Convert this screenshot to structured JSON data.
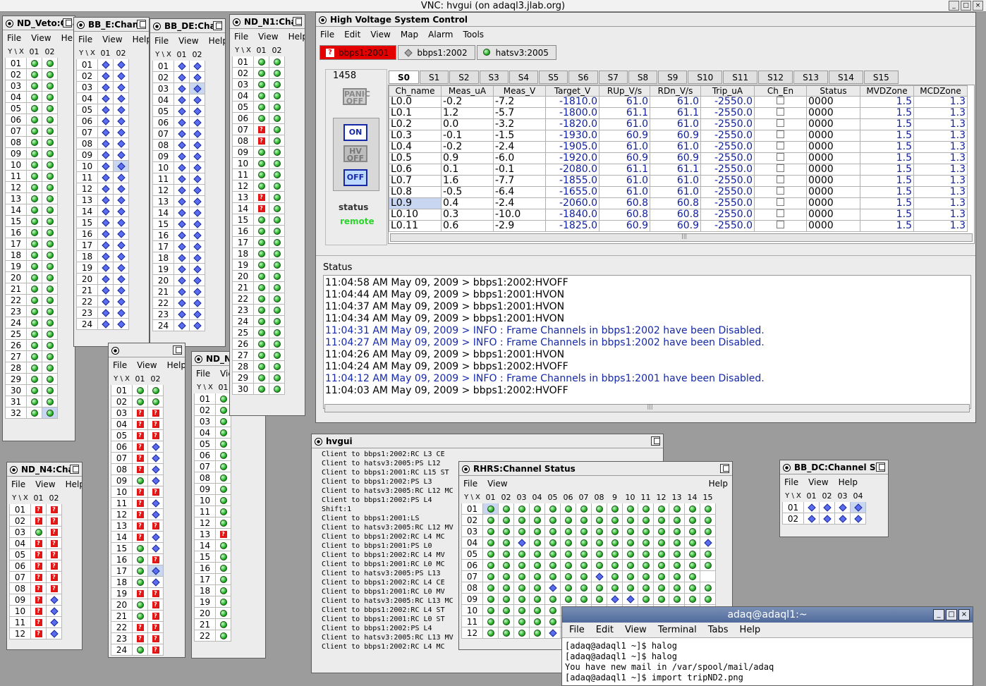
{
  "vnc_title": "VNC: hvgui (on adaql3.jlab.org)",
  "vnc_buttons": [
    "_",
    "□",
    "×"
  ],
  "menu_small": [
    "File",
    "View",
    "Help"
  ],
  "menus_hv": [
    "File",
    "Edit",
    "View",
    "Map",
    "Alarm",
    "Tools"
  ],
  "icons": {
    "green": "green-circle-icon",
    "blue": "blue-diamond-icon",
    "red": "red-question-icon"
  },
  "grid_windows": [
    {
      "id": "nd-veto",
      "title": "ND_Veto:Cha",
      "cols": [
        "01",
        "02"
      ],
      "rows": [
        [
          "01",
          "gg"
        ],
        [
          "02",
          "gg"
        ],
        [
          "03",
          "gg"
        ],
        [
          "04",
          "gg"
        ],
        [
          "05",
          "gg"
        ],
        [
          "06",
          "gg"
        ],
        [
          "07",
          "gg"
        ],
        [
          "08",
          "gg"
        ],
        [
          "09",
          "gg"
        ],
        [
          "10",
          "gg"
        ],
        [
          "11",
          "gg"
        ],
        [
          "12",
          "gg"
        ],
        [
          "13",
          "gg"
        ],
        [
          "14",
          "gg"
        ],
        [
          "15",
          "gg"
        ],
        [
          "16",
          "gg"
        ],
        [
          "17",
          "gg"
        ],
        [
          "18",
          "gg"
        ],
        [
          "19",
          "gg"
        ],
        [
          "20",
          "gg"
        ],
        [
          "21",
          "gg"
        ],
        [
          "22",
          "gg"
        ],
        [
          "23",
          "gg"
        ],
        [
          "24",
          "gg"
        ],
        [
          "25",
          "gg"
        ],
        [
          "26",
          "gg"
        ],
        [
          "27",
          "gg"
        ],
        [
          "28",
          "gg"
        ],
        [
          "29",
          "gg"
        ],
        [
          "30",
          "gg"
        ],
        [
          "31",
          "gg"
        ],
        [
          "32",
          "gG"
        ]
      ]
    },
    {
      "id": "bb-e",
      "title": "BB_E:Chan",
      "cols": [
        "01",
        "02"
      ],
      "rows": [
        [
          "01",
          "bb"
        ],
        [
          "02",
          "bb"
        ],
        [
          "03",
          "bb"
        ],
        [
          "04",
          "bb"
        ],
        [
          "05",
          "bb"
        ],
        [
          "06",
          "bb"
        ],
        [
          "07",
          "bb"
        ],
        [
          "08",
          "bb"
        ],
        [
          "09",
          "bb"
        ],
        [
          "10",
          "bB"
        ],
        [
          "11",
          "bb"
        ],
        [
          "12",
          "bb"
        ],
        [
          "13",
          "bb"
        ],
        [
          "14",
          "bb"
        ],
        [
          "15",
          "bb"
        ],
        [
          "16",
          "bb"
        ],
        [
          "17",
          "bb"
        ],
        [
          "18",
          "bb"
        ],
        [
          "19",
          "bb"
        ],
        [
          "20",
          "bb"
        ],
        [
          "21",
          "bb"
        ],
        [
          "22",
          "bb"
        ],
        [
          "23",
          "bb"
        ],
        [
          "24",
          "bb"
        ]
      ]
    },
    {
      "id": "bb-de",
      "title": "BB_DE:Cha",
      "cols": [
        "01",
        "02"
      ],
      "rows": [
        [
          "01",
          "bb"
        ],
        [
          "02",
          "bb"
        ],
        [
          "03",
          "bB"
        ],
        [
          "04",
          "bb"
        ],
        [
          "05",
          "bb"
        ],
        [
          "06",
          "bb"
        ],
        [
          "07",
          "bb"
        ],
        [
          "08",
          "bb"
        ],
        [
          "09",
          "bb"
        ],
        [
          "10",
          "bb"
        ],
        [
          "11",
          "bb"
        ],
        [
          "12",
          "bb"
        ],
        [
          "13",
          "bb"
        ],
        [
          "14",
          "bb"
        ],
        [
          "15",
          "bb"
        ],
        [
          "16",
          "bb"
        ],
        [
          "17",
          "bb"
        ],
        [
          "18",
          "bb"
        ],
        [
          "19",
          "bb"
        ],
        [
          "20",
          "bb"
        ],
        [
          "21",
          "bb"
        ],
        [
          "22",
          "bb"
        ],
        [
          "23",
          "bb"
        ],
        [
          "24",
          "bb"
        ]
      ]
    },
    {
      "id": "nd-n1",
      "title": "ND_N1:Cha",
      "cols": [
        "01",
        "02"
      ],
      "rows": [
        [
          "01",
          "gg"
        ],
        [
          "02",
          "gg"
        ],
        [
          "03",
          "gg"
        ],
        [
          "04",
          "gg"
        ],
        [
          "05",
          "gg"
        ],
        [
          "06",
          "gg"
        ],
        [
          "07",
          "rg"
        ],
        [
          "08",
          "rg"
        ],
        [
          "09",
          "gg"
        ],
        [
          "10",
          "gg"
        ],
        [
          "11",
          "gg"
        ],
        [
          "12",
          "gg"
        ],
        [
          "13",
          "rg"
        ],
        [
          "14",
          "rg"
        ],
        [
          "15",
          "gg"
        ],
        [
          "16",
          "gg"
        ],
        [
          "17",
          "gg"
        ],
        [
          "18",
          "gg"
        ],
        [
          "19",
          "gg"
        ],
        [
          "20",
          "gg"
        ],
        [
          "21",
          "gg"
        ],
        [
          "22",
          "gg"
        ],
        [
          "23",
          "gg"
        ],
        [
          "24",
          "gg"
        ],
        [
          "25",
          "gg"
        ],
        [
          "26",
          "gg"
        ],
        [
          "27",
          "gg"
        ],
        [
          "28",
          "gg"
        ],
        [
          "29",
          "gg"
        ],
        [
          "30",
          "gg"
        ]
      ]
    },
    {
      "id": "mid1",
      "title": "",
      "cols": [
        "01",
        "02"
      ],
      "rows": [
        [
          "01",
          "gg"
        ],
        [
          "02",
          "gg"
        ],
        [
          "03",
          "rr"
        ],
        [
          "04",
          "rr"
        ],
        [
          "05",
          "rr"
        ],
        [
          "06",
          "rb"
        ],
        [
          "07",
          "rb"
        ],
        [
          "08",
          "rb"
        ],
        [
          "09",
          "gb"
        ],
        [
          "10",
          "rr"
        ],
        [
          "11",
          "rb"
        ],
        [
          "12",
          "rb"
        ],
        [
          "13",
          "rr"
        ],
        [
          "14",
          "rb"
        ],
        [
          "15",
          "gb"
        ],
        [
          "16",
          "gr"
        ],
        [
          "17",
          "gB"
        ],
        [
          "18",
          "gb"
        ],
        [
          "19",
          "rr"
        ],
        [
          "20",
          "gr"
        ],
        [
          "21",
          "gr"
        ],
        [
          "22",
          "rr"
        ],
        [
          "23",
          "rr"
        ],
        [
          "24",
          "gr"
        ]
      ]
    },
    {
      "id": "nd-n",
      "title": "ND_N",
      "cols": [
        "01"
      ],
      "rows": [
        [
          "01",
          "gb"
        ],
        [
          "02",
          "gb"
        ],
        [
          "03",
          "gb"
        ],
        [
          "04",
          "gb"
        ],
        [
          "05",
          "gb"
        ],
        [
          "06",
          "gb"
        ],
        [
          "07",
          "gr"
        ],
        [
          "08",
          "gb"
        ],
        [
          "09",
          "gr"
        ],
        [
          "10",
          "gb"
        ],
        [
          "11",
          "gb"
        ],
        [
          "12",
          "gB"
        ],
        [
          "13",
          "rb"
        ],
        [
          "14",
          "gb"
        ],
        [
          "15",
          "gr"
        ],
        [
          "16",
          "gb"
        ],
        [
          "17",
          "gb"
        ],
        [
          "18",
          "gb"
        ],
        [
          "19",
          "gb"
        ],
        [
          "20",
          "gb"
        ],
        [
          "21",
          "gb"
        ],
        [
          "22",
          "gb"
        ]
      ]
    },
    {
      "id": "nd-n4",
      "title": "ND_N4:Cha",
      "cols": [
        "01",
        "02"
      ],
      "rows": [
        [
          "01",
          "rr"
        ],
        [
          "02",
          "rr"
        ],
        [
          "03",
          "gr"
        ],
        [
          "04",
          "rr"
        ],
        [
          "05",
          "rr"
        ],
        [
          "06",
          "rr"
        ],
        [
          "07",
          "rr"
        ],
        [
          "08",
          "rr"
        ],
        [
          "09",
          "rb"
        ],
        [
          "10",
          "rb"
        ],
        [
          "11",
          "rb"
        ],
        [
          "12",
          "rb"
        ]
      ]
    },
    {
      "id": "bb-dc",
      "title": "BB_DC:Channel Sta",
      "cols": [
        "01",
        "02",
        "03",
        "04"
      ],
      "rows": [
        [
          "01",
          "bbbB"
        ],
        [
          "02",
          "bbbb"
        ]
      ]
    }
  ],
  "grid_xy": "Y \\ X",
  "hv": {
    "title": "High Voltage System Control",
    "device_tabs": [
      {
        "label": "bbps1:2001",
        "type": "alarm"
      },
      {
        "label": "bbps1:2002",
        "type": "dm"
      },
      {
        "label": "hatsv3:2005",
        "type": "ok"
      }
    ],
    "crate_id": "1458",
    "panic_label": "PANIC OFF",
    "on_label": "ON",
    "hvoff_label": "HV OFF",
    "off_label": "OFF",
    "status_label": "status",
    "status_value": "remote",
    "slot_tabs": [
      "S0",
      "S1",
      "S2",
      "S3",
      "S4",
      "S5",
      "S6",
      "S7",
      "S8",
      "S9",
      "S10",
      "S11",
      "S12",
      "S13",
      "S14",
      "S15"
    ],
    "columns": [
      "Ch_name",
      "Meas_uA",
      "Meas_V",
      "Target_V",
      "RUp_V/s",
      "RDn_V/s",
      "Trip_uA",
      "Ch_En",
      "Status",
      "MVDZone",
      "MCDZone"
    ],
    "rows": [
      [
        "L0.0",
        "-0.2",
        "-7.2",
        "-1810.0",
        "61.0",
        "61.0",
        "-2550.0",
        "",
        "0000",
        "1.5",
        "1.3"
      ],
      [
        "L0.1",
        "1.2",
        "-5.7",
        "-1800.0",
        "61.1",
        "61.1",
        "-2550.0",
        "",
        "0000",
        "1.5",
        "1.3"
      ],
      [
        "L0.2",
        "0.0",
        "-3.2",
        "-1820.0",
        "61.0",
        "61.0",
        "-2550.0",
        "",
        "0000",
        "1.5",
        "1.3"
      ],
      [
        "L0.3",
        "-0.1",
        "-1.5",
        "-1930.0",
        "60.9",
        "60.9",
        "-2550.0",
        "",
        "0000",
        "1.5",
        "1.3"
      ],
      [
        "L0.4",
        "-0.2",
        "-2.4",
        "-1905.0",
        "61.0",
        "61.0",
        "-2550.0",
        "",
        "0000",
        "1.5",
        "1.3"
      ],
      [
        "L0.5",
        "0.9",
        "-6.0",
        "-1920.0",
        "60.9",
        "60.9",
        "-2550.0",
        "",
        "0000",
        "1.5",
        "1.3"
      ],
      [
        "L0.6",
        "0.1",
        "-0.1",
        "-2080.0",
        "61.1",
        "61.1",
        "-2550.0",
        "",
        "0000",
        "1.5",
        "1.3"
      ],
      [
        "L0.7",
        "1.6",
        "-7.7",
        "-1855.0",
        "61.0",
        "61.0",
        "-2550.0",
        "",
        "0000",
        "1.5",
        "1.3"
      ],
      [
        "L0.8",
        "-0.5",
        "-6.4",
        "-1655.0",
        "61.0",
        "61.0",
        "-2550.0",
        "",
        "0000",
        "1.5",
        "1.3"
      ],
      [
        "L0.9",
        "0.4",
        "-2.4",
        "-2060.0",
        "60.8",
        "60.8",
        "-2550.0",
        "",
        "0000",
        "1.5",
        "1.3"
      ],
      [
        "L0.10",
        "0.3",
        "-10.0",
        "-1840.0",
        "60.8",
        "60.8",
        "-2550.0",
        "",
        "0000",
        "1.5",
        "1.3"
      ],
      [
        "L0.11",
        "0.6",
        "-2.9",
        "-1825.0",
        "60.9",
        "60.9",
        "-2550.0",
        "",
        "0000",
        "1.5",
        "1.3"
      ]
    ],
    "status_title": "Status",
    "log": [
      {
        "t": "11:04:58 AM May 09, 2009 > bbps1:2002:HVOFF",
        "info": false
      },
      {
        "t": "11:04:44 AM May 09, 2009 > bbps1:2001:HVON",
        "info": false
      },
      {
        "t": "11:04:37 AM May 09, 2009 > bbps1:2001:HVON",
        "info": false
      },
      {
        "t": "11:04:34 AM May 09, 2009 > bbps1:2001:HVON",
        "info": false
      },
      {
        "t": "11:04:31 AM May 09, 2009 > INFO : Frame Channels in bbps1:2002 have been Disabled.",
        "info": true
      },
      {
        "t": "11:04:27 AM May 09, 2009 > INFO : Frame Channels in bbps1:2002 have been Disabled.",
        "info": true
      },
      {
        "t": "11:04:26 AM May 09, 2009 > bbps1:2001:HVON",
        "info": false
      },
      {
        "t": "11:04:24 AM May 09, 2009 > bbps1:2002:HVOFF",
        "info": false
      },
      {
        "t": "11:04:12 AM May 09, 2009 > INFO : Frame Channels in bbps1:2001 have been Disabled.",
        "info": true
      },
      {
        "t": "11:04:03 AM May 09, 2009 > bbps1:2002:HVOFF",
        "info": false
      }
    ]
  },
  "hvgui": {
    "title": "hvgui",
    "lines": [
      "Client to bbps1:2002:RC L3 CE",
      "Client to hatsv3:2005:PS L12",
      "Client to bbps1:2001:RC L15 ST",
      "Client to bbps1:2002:PS L3",
      "Client to hatsv3:2005:RC L12 MC",
      "Client to bbps1:2002:PS L4",
      "Shift:1",
      "Client to bbps1:2001:LS",
      "Client to hatsv3:2005:RC L12 MV",
      "Client to bbps1:2002:RC L4 MC",
      "Client to bbps1:2001:PS L0",
      "Client to bbps1:2002:RC L4 MV",
      "Client to bbps1:2001:RC L0 MC",
      "Client to hatsv3:2005:PS L13",
      "Client to bbps1:2002:RC L4 CE",
      "Client to bbps1:2001:RC L0 MV",
      "Client to hatsv3:2005:RC L13 MC",
      "Client to bbps1:2002:RC L4 ST",
      "Client to bbps1:2001:RC L0 ST",
      "Client to bbps1:2002:PS L4",
      "Client to hatsv3:2005:RC L13 MV",
      "Client to bbps1:2002:RC L4 MC"
    ]
  },
  "rhrs": {
    "title": "RHRS:Channel Status",
    "menu": [
      "File",
      "View"
    ],
    "help": "Help",
    "cols": [
      "01",
      "02",
      "03",
      "04",
      "05",
      "06",
      "07",
      "08",
      "9",
      "10",
      "11",
      "12",
      "13",
      "14",
      "15"
    ],
    "rows": [
      [
        "01",
        "Gggggggggggggggg"
      ],
      [
        "02",
        "ggggggggggggggg"
      ],
      [
        "03",
        "ggggggggggggggg"
      ],
      [
        "04",
        "ggbgggggggggggb"
      ],
      [
        "05",
        "ggggggggggggggg"
      ],
      [
        "06",
        "ggggggggggggggg"
      ],
      [
        "07",
        "gggggggbgggggg"
      ],
      [
        "08",
        "ggggbggggggggggg"
      ],
      [
        "09",
        "ggggggggbbgggggb"
      ],
      [
        "10",
        "gggggg"
      ],
      [
        "11",
        "gggggg"
      ],
      [
        "12",
        "ggggbg"
      ]
    ]
  },
  "terminal": {
    "title": "adaq@adaql1:~",
    "menu": [
      "File",
      "Edit",
      "View",
      "Terminal",
      "Tabs",
      "Help"
    ],
    "lines": [
      "[adaq@adaql1 ~]$ halog",
      "[adaq@adaql1 ~]$ halog",
      "You have new mail in /var/spool/mail/adaq",
      "[adaq@adaql1 ~]$ import tripND2.png"
    ]
  }
}
